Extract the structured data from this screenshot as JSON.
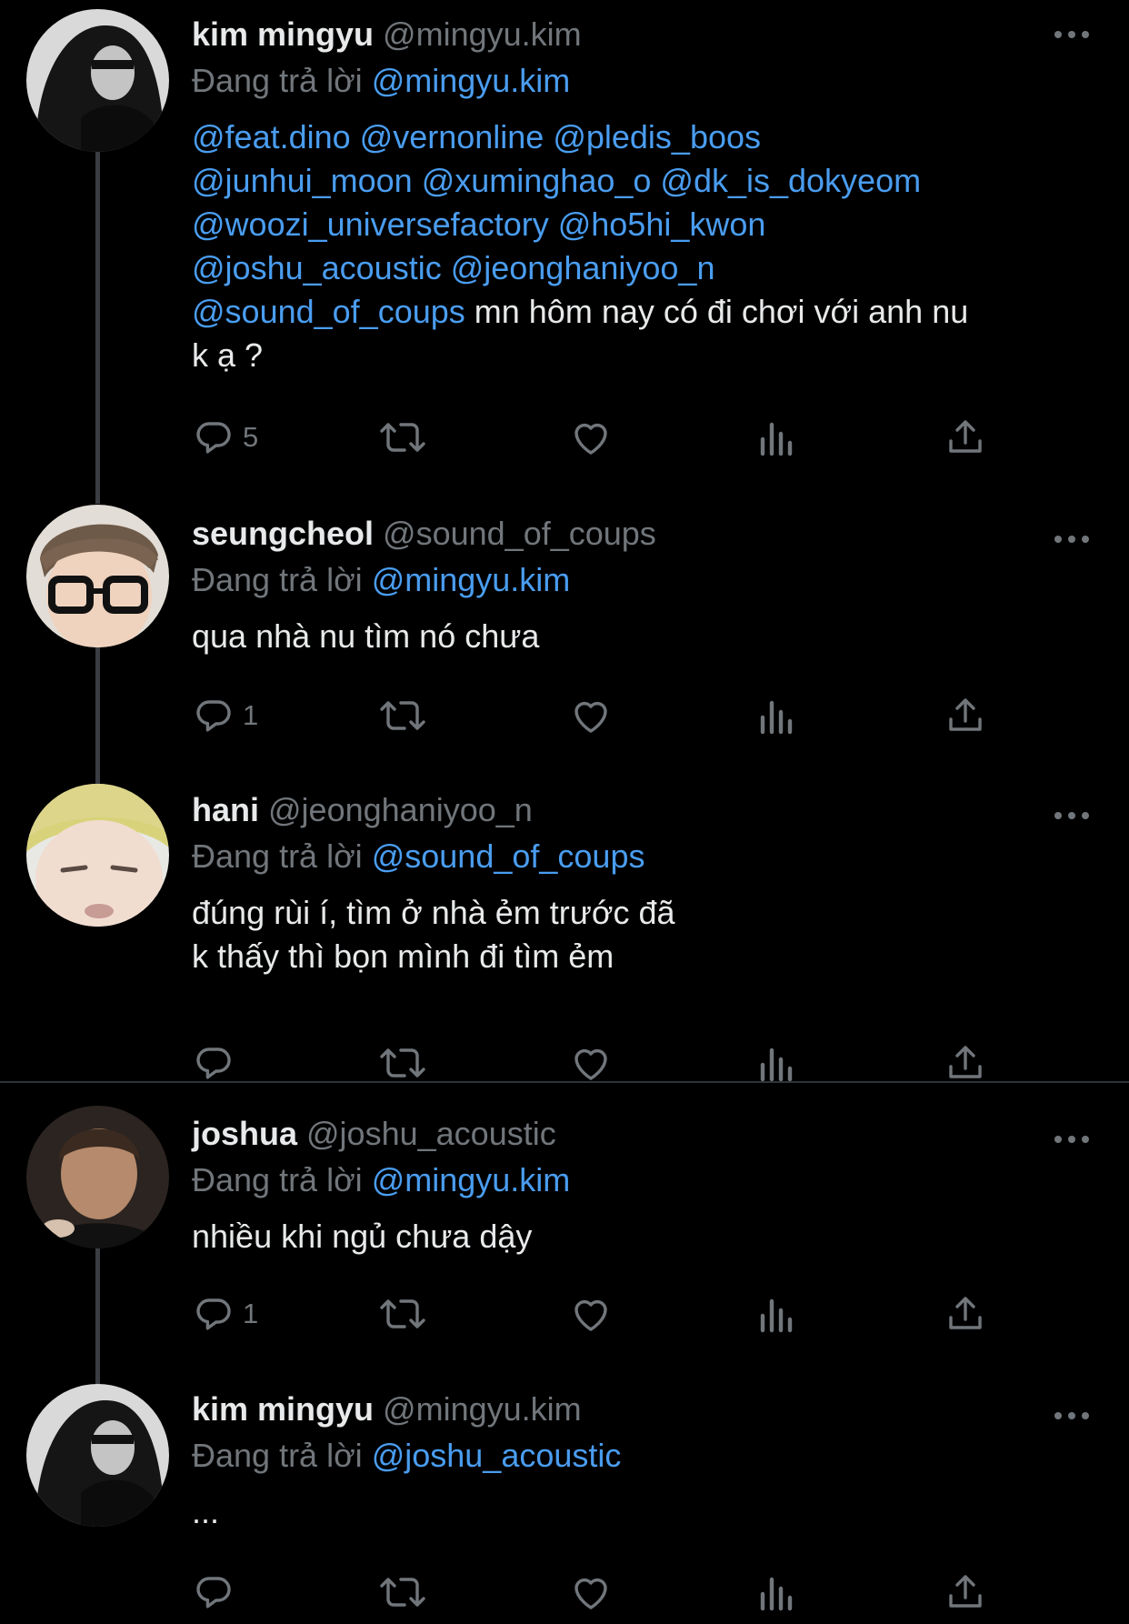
{
  "tweets": [
    {
      "author_name": "kim mingyu",
      "author_handle": "@mingyu.kim",
      "reply_prefix": "Đang trả lời",
      "reply_to": "@mingyu.kim",
      "mentions_block": "@feat.dino @vernonline @pledis_boos\n@junhui_moon @xuminghao_o @dk_is_dokyeom\n@woozi_universefactory @ho5hi_kwon\n@joshu_acoustic @jeonghaniyoo_n\n@sound_of_coups",
      "text": " mn hôm nay có đi chơi với anh nu\nk ạ ?",
      "reply_count": "5",
      "avatar_icon": "hooded-figure-avatar"
    },
    {
      "author_name": "seungcheol",
      "author_handle": "@sound_of_coups",
      "reply_prefix": "Đang trả lời",
      "reply_to": "@mingyu.kim",
      "text": "qua nhà nu tìm nó chưa",
      "reply_count": "1",
      "avatar_icon": "glasses-person-avatar"
    },
    {
      "author_name": "hani",
      "author_handle": "@jeonghaniyoo_n",
      "reply_prefix": "Đang trả lời",
      "reply_to": "@sound_of_coups",
      "text": "đúng rùi í, tìm ở nhà ẻm trước đã\nk thấy thì bọn mình đi tìm ẻm",
      "reply_count": "",
      "avatar_icon": "blond-person-avatar"
    },
    {
      "author_name": "joshua",
      "author_handle": "@joshu_acoustic",
      "reply_prefix": "Đang trả lời",
      "reply_to": "@mingyu.kim",
      "text": "nhiều khi ngủ chưa dậy",
      "reply_count": "1",
      "avatar_icon": "dark-person-avatar"
    },
    {
      "author_name": "kim mingyu",
      "author_handle": "@mingyu.kim",
      "reply_prefix": "Đang trả lời",
      "reply_to": "@joshu_acoustic",
      "text": "...",
      "reply_count": "",
      "avatar_icon": "hooded-figure-avatar"
    }
  ],
  "colors": {
    "background": "#000000",
    "text": "#e7e9ea",
    "secondary": "#71767b",
    "mention": "#4a9df0",
    "thread_line": "#3a3e42",
    "divider": "#2f3336"
  },
  "icons": [
    "reply-icon",
    "retweet-icon",
    "like-icon",
    "views-icon",
    "share-icon",
    "more-options-icon"
  ]
}
